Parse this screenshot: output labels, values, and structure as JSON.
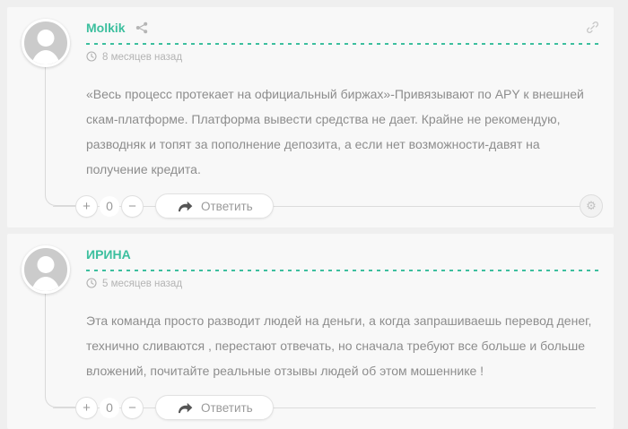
{
  "comments": [
    {
      "author": "Molkik",
      "time_ago": "8 месяцев назад",
      "body": "«Весь процесс протекает на официальный биржах»-Привязывают по APY к внешней скам-платформе. Платформа вывести средства не дает. Крайне не рекомендую, разводняк и топят за пополнение депозита, а если нет возможности-давят на получение кредита.",
      "vote_count": "0",
      "reply_label": "Ответить"
    },
    {
      "author": "ИРИНА",
      "time_ago": "5 месяцев назад",
      "body": "Эта команда просто разводит людей на деньги, а когда запрашиваешь перевод денег, технично сливаются , перестают отвечать, но сначала требуют все больше и больше вложений, почитайте реальные отзывы людей об этом мошеннике !",
      "vote_count": "0",
      "reply_label": "Ответить"
    }
  ],
  "glyphs": {
    "plus": "+",
    "minus": "−",
    "gear": "⚙"
  },
  "colors": {
    "accent": "#3cbf9e",
    "page_bg": "#efefef",
    "card_bg": "#f8f8f8",
    "body_text": "#8d8d8d",
    "timestamp_text": "#b4b4b4"
  }
}
